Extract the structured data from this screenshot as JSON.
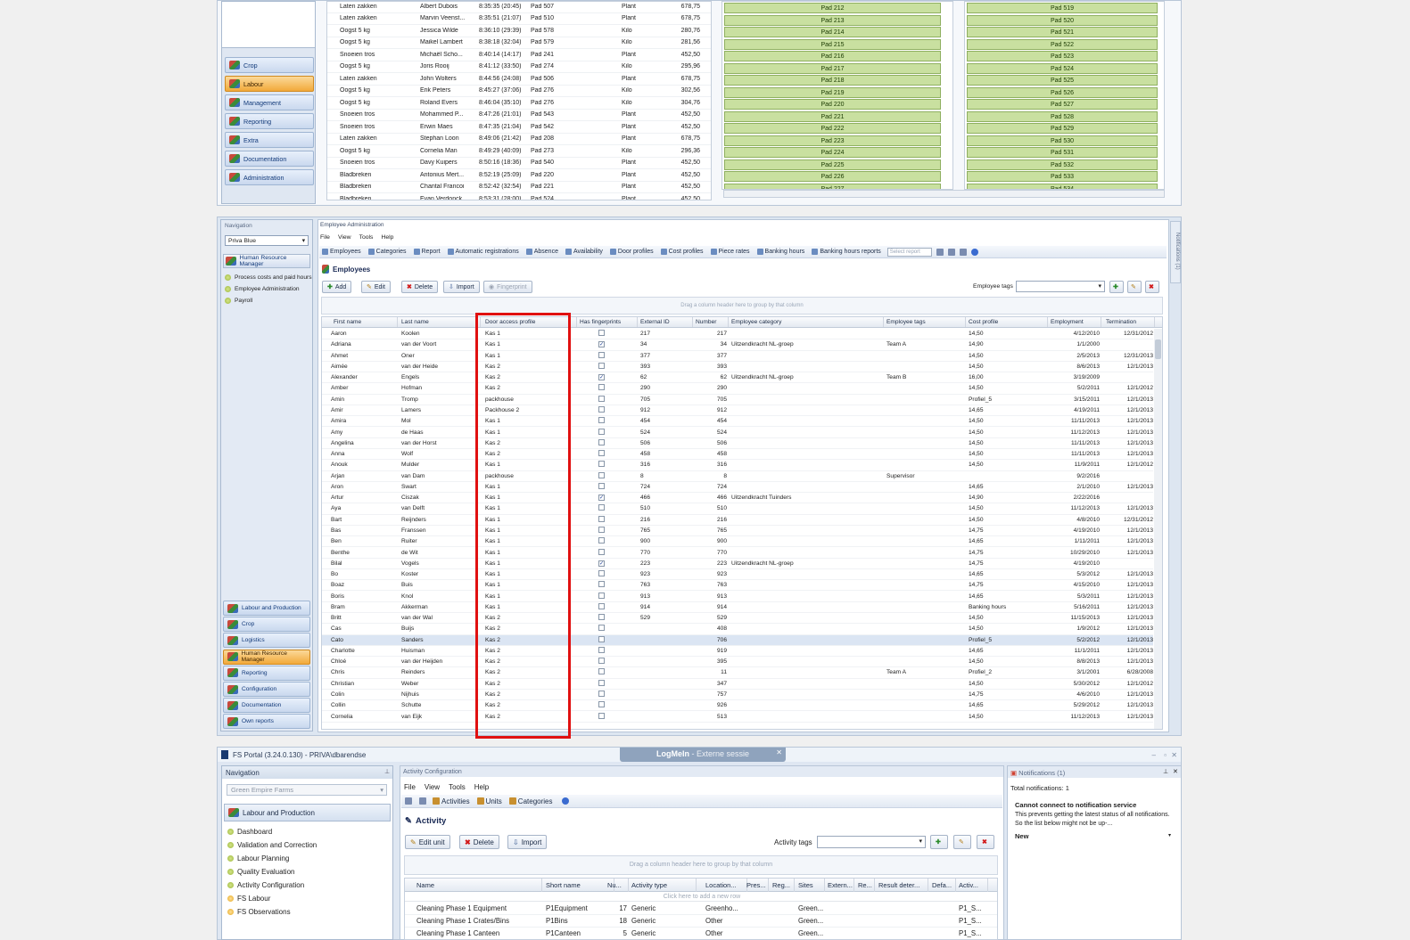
{
  "top": {
    "nav_items": [
      "Crop",
      "Labour",
      "Management",
      "Reporting",
      "Extra",
      "Documentation",
      "Administration"
    ],
    "rows": [
      [
        "Laten zakken",
        "Albert Dubois",
        "8:35:35 (20:45)",
        "Pad 507",
        "Plant",
        "678,75"
      ],
      [
        "Laten zakken",
        "Marvin Veenst...",
        "8:35:51 (21:07)",
        "Pad 510",
        "Plant",
        "678,75"
      ],
      [
        "Oogst 5 kg",
        "Jessica Wilde",
        "8:36:10 (29:39)",
        "Pad 578",
        "Kilo",
        "280,76"
      ],
      [
        "Oogst 5 kg",
        "Maikel Lambert",
        "8:38:18 (32:04)",
        "Pad 579",
        "Kilo",
        "281,56"
      ],
      [
        "Snoeien tros",
        "Michaël Scho...",
        "8:40:14 (14:17)",
        "Pad 241",
        "Plant",
        "452,50"
      ],
      [
        "Oogst 5 kg",
        "Joris Rooij",
        "8:41:12 (33:50)",
        "Pad 274",
        "Kilo",
        "295,96"
      ],
      [
        "Laten zakken",
        "John Wolters",
        "8:44:56 (24:08)",
        "Pad 506",
        "Plant",
        "678,75"
      ],
      [
        "Oogst 5 kg",
        "Erik Peters",
        "8:45:27 (37:06)",
        "Pad 276",
        "Kilo",
        "302,56"
      ],
      [
        "Oogst 5 kg",
        "Roland Evers",
        "8:46:04 (35:10)",
        "Pad 276",
        "Kilo",
        "304,76"
      ],
      [
        "Snoeien tros",
        "Mohammed P...",
        "8:47:26 (21:01)",
        "Pad 543",
        "Plant",
        "452,50"
      ],
      [
        "Snoeien tros",
        "Erwin Maes",
        "8:47:35 (21:04)",
        "Pad 542",
        "Plant",
        "452,50"
      ],
      [
        "Laten zakken",
        "Stephan Loon",
        "8:49:06 (21:42)",
        "Pad 208",
        "Plant",
        "678,75"
      ],
      [
        "Oogst 5 kg",
        "Cornelia Man",
        "8:49:29 (40:09)",
        "Pad 273",
        "Kilo",
        "296,36"
      ],
      [
        "Snoeien tros",
        "Davy Kuipers",
        "8:50:16 (18:36)",
        "Pad 540",
        "Plant",
        "452,50"
      ],
      [
        "Bladbreken",
        "Antonius Mert...",
        "8:52:19 (25:09)",
        "Pad 220",
        "Plant",
        "452,50"
      ],
      [
        "Bladbreken",
        "Chantal Francoi",
        "8:52:42 (32:54)",
        "Pad 221",
        "Plant",
        "452,50"
      ],
      [
        "Bladbreken",
        "Evan Verdonck",
        "8:53:31 (28:00)",
        "Pad 524",
        "Plant",
        "452,50"
      ]
    ],
    "pads_left": [
      "Pad 212",
      "Pad 213",
      "Pad 214",
      "Pad 215",
      "Pad 216",
      "Pad 217",
      "Pad 218",
      "Pad 219",
      "Pad 220",
      "Pad 221",
      "Pad 222",
      "Pad 223",
      "Pad 224",
      "Pad 225",
      "Pad 226",
      "Pad 227"
    ],
    "pads_right": [
      "Pad 519",
      "Pad 520",
      "Pad 521",
      "Pad 522",
      "Pad 523",
      "Pad 524",
      "Pad 525",
      "Pad 526",
      "Pad 527",
      "Pad 528",
      "Pad 529",
      "Pad 530",
      "Pad 531",
      "Pad 532",
      "Pad 533",
      "Pad 534"
    ]
  },
  "mid": {
    "nav_title": "Navigation",
    "nav_select": "Priva Blue",
    "nav_module": "Human Resource Manager",
    "nav_tree": [
      "Process costs and paid hours",
      "Employee Administration",
      "Payroll"
    ],
    "nav_buttons": [
      "Labour and Production",
      "Crop",
      "Logistics",
      "Human Resource Manager",
      "Reporting",
      "Configuration",
      "Documentation",
      "Own reports"
    ],
    "window_title": "Employee Administration",
    "menu": [
      "File",
      "View",
      "Tools",
      "Help"
    ],
    "toolbar": [
      "Employees",
      "Categories",
      "Report",
      "Automatic registrations",
      "Absence",
      "Availability",
      "Door profiles",
      "Cost profiles",
      "Piece rates",
      "Banking hours",
      "Banking hours reports"
    ],
    "select_report": "Select report",
    "section_title": "Employees",
    "buttons": {
      "add": "Add",
      "edit": "Edit",
      "delete": "Delete",
      "import": "Import",
      "fingerprint": "Fingerprint"
    },
    "employee_tags_label": "Employee tags",
    "group_hint": "Drag a column header here to group by that column",
    "side_tab": "Notifications (1)",
    "columns": [
      "First name",
      "Last name",
      "Door access profile",
      "Has fingerprints",
      "External ID",
      "Number",
      "Employee category",
      "Employee tags",
      "Cost profile",
      "Employment",
      "Termination"
    ],
    "rows": [
      [
        "Aaron",
        "Koolen",
        "Kas 1",
        false,
        "217",
        "217",
        "",
        "",
        "14,50",
        "4/12/2010",
        "12/31/2012"
      ],
      [
        "Adriana",
        "van der Voort",
        "Kas 1",
        true,
        "34",
        "34",
        "Uitzendkracht NL-groep",
        "Team A",
        "14,90",
        "1/1/2000",
        ""
      ],
      [
        "Ahmet",
        "Oner",
        "Kas 1",
        false,
        "377",
        "377",
        "",
        "",
        "14,50",
        "2/5/2013",
        "12/31/2013"
      ],
      [
        "Aimée",
        "van der Heide",
        "Kas 2",
        false,
        "393",
        "393",
        "",
        "",
        "14,50",
        "8/6/2013",
        "12/1/2013"
      ],
      [
        "Alexander",
        "Engels",
        "Kas 2",
        true,
        "62",
        "62",
        "Uitzendkracht NL-groep",
        "Team B",
        "16,00",
        "3/19/2009",
        ""
      ],
      [
        "Amber",
        "Hofman",
        "Kas 2",
        false,
        "290",
        "290",
        "",
        "",
        "14,50",
        "5/2/2011",
        "12/1/2012"
      ],
      [
        "Amin",
        "Tromp",
        "packhouse",
        false,
        "705",
        "705",
        "",
        "",
        "Profiel_5",
        "3/15/2011",
        "12/1/2013"
      ],
      [
        "Amir",
        "Lamers",
        "Packhouse 2",
        false,
        "912",
        "912",
        "",
        "",
        "14,65",
        "4/19/2011",
        "12/1/2013"
      ],
      [
        "Amira",
        "Mol",
        "Kas 1",
        false,
        "454",
        "454",
        "",
        "",
        "14,50",
        "11/11/2013",
        "12/1/2013"
      ],
      [
        "Amy",
        "de Haas",
        "Kas 1",
        false,
        "524",
        "524",
        "",
        "",
        "14,50",
        "11/12/2013",
        "12/1/2013"
      ],
      [
        "Angelina",
        "van der Horst",
        "Kas 2",
        false,
        "506",
        "506",
        "",
        "",
        "14,50",
        "11/11/2013",
        "12/1/2013"
      ],
      [
        "Anna",
        "Wolf",
        "Kas 2",
        false,
        "458",
        "458",
        "",
        "",
        "14,50",
        "11/11/2013",
        "12/1/2013"
      ],
      [
        "Anouk",
        "Mulder",
        "Kas 1",
        false,
        "316",
        "316",
        "",
        "",
        "14,50",
        "11/9/2011",
        "12/1/2012"
      ],
      [
        "Arjan",
        "van Dam",
        "packhouse",
        false,
        "8",
        "8",
        "",
        "Supervisor",
        "",
        "9/2/2016",
        ""
      ],
      [
        "Aron",
        "Swart",
        "Kas 1",
        false,
        "724",
        "724",
        "",
        "",
        "14,65",
        "2/1/2010",
        "12/1/2013"
      ],
      [
        "Artur",
        "Ciszak",
        "Kas 1",
        true,
        "466",
        "466",
        "Uitzendkracht Tuinders",
        "",
        "14,90",
        "2/22/2016",
        ""
      ],
      [
        "Aya",
        "van Delft",
        "Kas 1",
        false,
        "510",
        "510",
        "",
        "",
        "14,50",
        "11/12/2013",
        "12/1/2013"
      ],
      [
        "Bart",
        "Reijnders",
        "Kas 1",
        false,
        "216",
        "216",
        "",
        "",
        "14,50",
        "4/8/2010",
        "12/31/2012"
      ],
      [
        "Bas",
        "Franssen",
        "Kas 1",
        false,
        "765",
        "765",
        "",
        "",
        "14,75",
        "4/19/2010",
        "12/1/2013"
      ],
      [
        "Ben",
        "Ruiter",
        "Kas 1",
        false,
        "900",
        "900",
        "",
        "",
        "14,65",
        "1/11/2011",
        "12/1/2013"
      ],
      [
        "Benthe",
        "de Wit",
        "Kas 1",
        false,
        "770",
        "770",
        "",
        "",
        "14,75",
        "10/29/2010",
        "12/1/2013"
      ],
      [
        "Bilal",
        "Vogels",
        "Kas 1",
        true,
        "223",
        "223",
        "Uitzendkracht NL-groep",
        "",
        "14,75",
        "4/19/2010",
        ""
      ],
      [
        "Bo",
        "Koster",
        "Kas 1",
        false,
        "923",
        "923",
        "",
        "",
        "14,65",
        "5/3/2012",
        "12/1/2013"
      ],
      [
        "Boaz",
        "Buis",
        "Kas 1",
        false,
        "763",
        "763",
        "",
        "",
        "14,75",
        "4/15/2010",
        "12/1/2013"
      ],
      [
        "Boris",
        "Knol",
        "Kas 1",
        false,
        "913",
        "913",
        "",
        "",
        "14,65",
        "5/3/2011",
        "12/1/2013"
      ],
      [
        "Bram",
        "Akkerman",
        "Kas 1",
        false,
        "914",
        "914",
        "",
        "",
        "Banking hours",
        "5/16/2011",
        "12/1/2013"
      ],
      [
        "Britt",
        "van der Wal",
        "Kas 2",
        false,
        "529",
        "529",
        "",
        "",
        "14,50",
        "11/15/2013",
        "12/1/2013"
      ],
      [
        "Cas",
        "Buijs",
        "Kas 2",
        false,
        "",
        "408",
        "",
        "",
        "14,50",
        "1/9/2012",
        "12/1/2013"
      ],
      [
        "Cato",
        "Sanders",
        "Kas 2",
        false,
        "",
        "706",
        "",
        "",
        "Profiel_5",
        "5/2/2012",
        "12/1/2013"
      ],
      [
        "Charlotte",
        "Huisman",
        "Kas 2",
        false,
        "",
        "919",
        "",
        "",
        "14,65",
        "11/1/2011",
        "12/1/2013"
      ],
      [
        "Chloé",
        "van der Heijden",
        "Kas 2",
        false,
        "",
        "395",
        "",
        "",
        "14,50",
        "8/8/2013",
        "12/1/2013"
      ],
      [
        "Chris",
        "Reinders",
        "Kas 2",
        false,
        "",
        "11",
        "",
        "Team A",
        "Profiel_2",
        "3/1/2001",
        "6/28/2008"
      ],
      [
        "Christian",
        "Weber",
        "Kas 2",
        false,
        "",
        "347",
        "",
        "",
        "14,50",
        "5/30/2012",
        "12/1/2012"
      ],
      [
        "Colin",
        "Nijhuis",
        "Kas 2",
        false,
        "",
        "757",
        "",
        "",
        "14,75",
        "4/6/2010",
        "12/1/2013"
      ],
      [
        "Collin",
        "Schutte",
        "Kas 2",
        false,
        "",
        "926",
        "",
        "",
        "14,65",
        "5/29/2012",
        "12/1/2013"
      ],
      [
        "Cornelia",
        "van Eijk",
        "Kas 2",
        false,
        "",
        "513",
        "",
        "",
        "14,50",
        "11/12/2013",
        "12/1/2013"
      ]
    ],
    "selected_row": 28
  },
  "bottom": {
    "title": "FS Portal (3.24.0.130) - PRIVA\\dbarendse",
    "logmein": "LogMeIn",
    "logmein_sub": " - Externe sessie",
    "nav_title": "Navigation",
    "nav_select": "Green Empire Farms",
    "nav_module": "Labour and Production",
    "nav_items": [
      "Dashboard",
      "Validation and Correction",
      "Labour Planning",
      "Quality Evaluation",
      "Activity Configuration",
      "FS Labour",
      "FS Observations"
    ],
    "window_title": "Activity Configuration",
    "menu": [
      "File",
      "View",
      "Tools",
      "Help"
    ],
    "toolbar": [
      "Activities",
      "Units",
      "Categories"
    ],
    "section_title": "Activity",
    "buttons": {
      "edit_unit": "Edit unit",
      "delete": "Delete",
      "import": "Import"
    },
    "activity_tags_label": "Activity tags",
    "group_hint": "Drag a column header here to group by that column",
    "new_row_hint": "Click here to add a new row",
    "columns": [
      "Name",
      "Short name",
      "Nu...",
      "Activity type",
      "Location...",
      "Pres...",
      "Reg...",
      "Sites",
      "Extern...",
      "Re...",
      "Result deter...",
      "Defa...",
      "Activ..."
    ],
    "rows": [
      [
        "Cleaning Phase 1 Equipment",
        "P1Equipment",
        "17",
        "Generic",
        "Greenho...",
        "",
        "",
        "Green...",
        "",
        "",
        "",
        "",
        "P1_S..."
      ],
      [
        "Cleaning Phase 1 Crates/Bins",
        "P1Bins",
        "18",
        "Generic",
        "Other",
        "",
        "",
        "Green...",
        "",
        "",
        "",
        "",
        "P1_S..."
      ],
      [
        "Cleaning Phase 1 Canteen",
        "P1Canteen",
        "5",
        "Generic",
        "Other",
        "",
        "",
        "Green...",
        "",
        "",
        "",
        "",
        "P1_S..."
      ]
    ],
    "notifications": {
      "title": "Notifications (1)",
      "total": "Total notifications: 1",
      "heading": "Cannot connect to notification service",
      "body": "This prevents getting the latest status of all notifications. So the list below might not be up-...",
      "status": "New"
    }
  }
}
